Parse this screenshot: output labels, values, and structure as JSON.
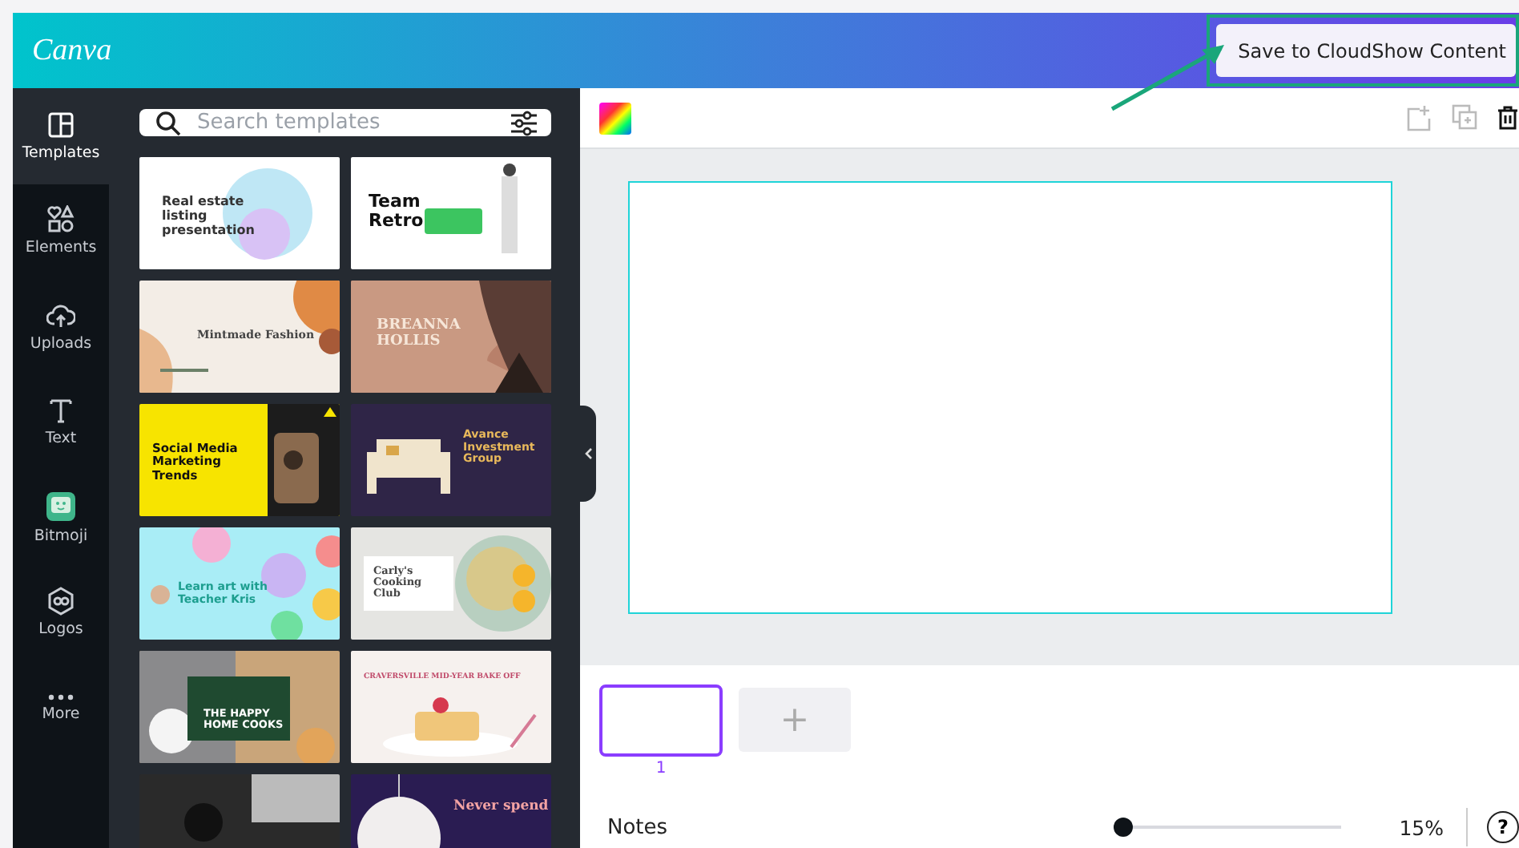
{
  "header": {
    "logo": "Canva",
    "save_button": "Save to CloudShow Content"
  },
  "sidebar": {
    "items": [
      {
        "kind": "templates",
        "label": "Templates",
        "selected": true
      },
      {
        "kind": "elements",
        "label": "Elements",
        "selected": false
      },
      {
        "kind": "uploads",
        "label": "Uploads",
        "selected": false
      },
      {
        "kind": "text",
        "label": "Text",
        "selected": false
      },
      {
        "kind": "bitmoji",
        "label": "Bitmoji",
        "selected": false
      },
      {
        "kind": "logos",
        "label": "Logos",
        "selected": false
      },
      {
        "kind": "more",
        "label": "More",
        "selected": false
      }
    ]
  },
  "panel": {
    "search": {
      "placeholder": "Search templates"
    },
    "templates": [
      {
        "kind": "gradient",
        "title": "Real estate listing presentation"
      },
      {
        "kind": "retro",
        "title": "Team Retro"
      },
      {
        "kind": "cream",
        "title": "Mintmade Fashion"
      },
      {
        "kind": "brown",
        "title": "BREANNA HOLLIS"
      },
      {
        "kind": "yellow",
        "title": "Social Media Marketing Trends"
      },
      {
        "kind": "purple",
        "title": "Avance Investment Group"
      },
      {
        "kind": "sky",
        "title": "Learn art with Teacher Kris"
      },
      {
        "kind": "food",
        "title": "Carly's Cooking Club"
      },
      {
        "kind": "green",
        "title": "THE HAPPY HOME COOKS"
      },
      {
        "kind": "bake",
        "title": "CRAVERSVILLE MID-YEAR BAKE OFF"
      },
      {
        "kind": "dark"
      },
      {
        "kind": "night",
        "title": "Never spend"
      }
    ]
  },
  "editor": {
    "pages": [
      {
        "number": "1",
        "selected": true
      }
    ],
    "add_page": "+",
    "notes": "Notes",
    "zoom": {
      "level": 0.0,
      "reading": "15%"
    },
    "help": "?"
  }
}
